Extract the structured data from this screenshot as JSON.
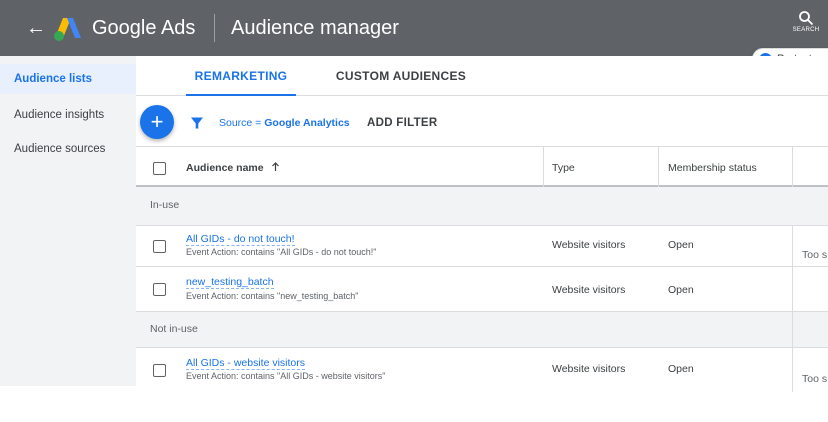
{
  "app": {
    "product": "Google Ads",
    "page_title": "Audience manager",
    "search_label": "SEARCH"
  },
  "notice": {
    "text": "Protect yo"
  },
  "sidebar": {
    "items": [
      {
        "label": "Audience lists",
        "active": true
      },
      {
        "label": "Audience insights",
        "active": false
      },
      {
        "label": "Audience sources",
        "active": false
      }
    ]
  },
  "tabs": [
    {
      "label": "REMARKETING",
      "active": true
    },
    {
      "label": "CUSTOM AUDIENCES",
      "active": false
    }
  ],
  "toolbar": {
    "add_icon": "plus-icon",
    "filter_icon": "funnel-icon",
    "filter_key": "Source = ",
    "filter_value": "Google Analytics",
    "add_filter_label": "ADD FILTER"
  },
  "table": {
    "columns": {
      "name": "Audience name",
      "type": "Type",
      "status": "Membership status"
    },
    "sort_icon": "arrow-up-icon",
    "sections": [
      {
        "label": "In-use",
        "rows": [
          {
            "name": "All GIDs - do not touch!",
            "description": "Event Action: contains \"All GIDs - do not touch!\"",
            "type": "Website visitors",
            "status": "Open",
            "extra": "Too s"
          },
          {
            "name": "new_testing_batch",
            "description": "Event Action: contains \"new_testing_batch\"",
            "type": "Website visitors",
            "status": "Open",
            "extra": ""
          }
        ]
      },
      {
        "label": "Not in-use",
        "rows": [
          {
            "name": "All GIDs - website visitors",
            "description": "Event Action: contains \"All GIDs - website visitors\"",
            "type": "Website visitors",
            "status": "Open",
            "extra": "Too s"
          }
        ]
      }
    ]
  },
  "colors": {
    "app_bar": "#5f6368",
    "accent": "#1a73e8",
    "sidebar_bg": "#f1f3f4",
    "active_item_bg": "#e8f0fe"
  }
}
